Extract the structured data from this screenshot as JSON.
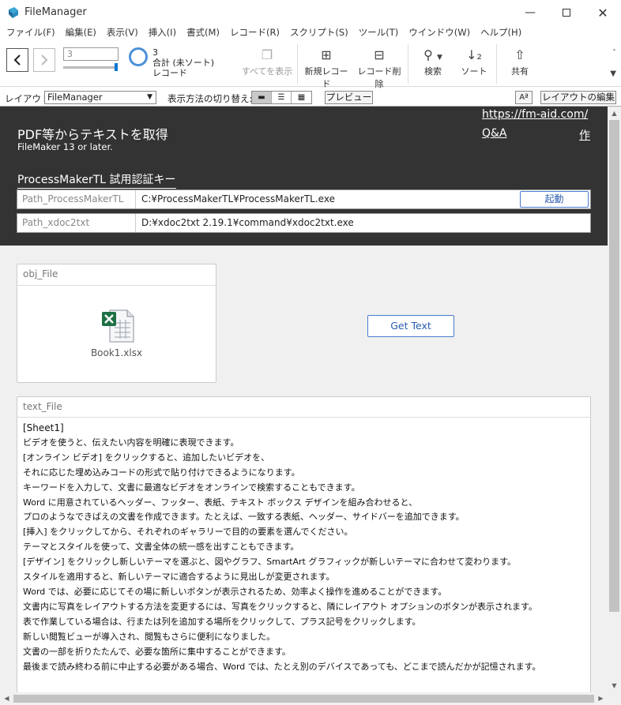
{
  "window": {
    "title": "FileManager"
  },
  "menu": [
    "ファイル(F)",
    "編集(E)",
    "表示(V)",
    "挿入(I)",
    "書式(M)",
    "レコード(R)",
    "スクリプト(S)",
    "ツール(T)",
    "ウインドウ(W)",
    "ヘルプ(H)"
  ],
  "toolbar": {
    "record_input": "3",
    "record_count": "3",
    "record_status": "合計 (未ソート)",
    "record_unit": "レコード",
    "show_all": "すべてを表示",
    "new_record": "新規レコード",
    "delete_record": "レコード削除",
    "search": "検索",
    "sort": "ソート",
    "share": "共有"
  },
  "layoutbar": {
    "layout_label": "レイアウト:",
    "layout_value": "FileManager",
    "view_label": "表示方法の切り替え:",
    "preview": "プレビュー",
    "font_btn": "Aª",
    "edit_layout": "レイアウトの編集"
  },
  "header": {
    "title": "PDF等からテキストを取得",
    "subtitle": "FileMaker 13 or later.",
    "site_link": "https://fm-aid.com/",
    "qa_link": "Q&A",
    "author_link": "作",
    "license_label": "ProcessMakerTL 試用認証キー",
    "fields": [
      {
        "name": "Path_ProcessMakerTL",
        "value": "C:¥ProcessMakerTL¥ProcessMakerTL.exe"
      },
      {
        "name": "Path_xdoc2txt",
        "value": "D:¥xdoc2txt 2.19.1¥command¥xdoc2txt.exe"
      }
    ],
    "launch_button": "起動"
  },
  "obj_file": {
    "label": "obj_File",
    "filename": "Book1.xlsx"
  },
  "get_text_button": "Get Text",
  "text_file": {
    "label": "text_File",
    "lines": [
      "[Sheet1]",
      "ビデオを使うと、伝えたい内容を明確に表現できます。",
      "[オンライン ビデオ] をクリックすると、追加したいビデオを、",
      "それに応じた埋め込みコードの形式で貼り付けできるようになります。",
      "キーワードを入力して、文書に最適なビデオをオンラインで検索することもできます。",
      "Word に用意されているヘッダー、フッター、表紙、テキスト ボックス デザインを組み合わせると、",
      "プロのようなできばえの文書を作成できます。たとえば、一致する表紙、ヘッダー、サイドバーを追加できます。",
      "[挿入] をクリックしてから、それぞれのギャラリーで目的の要素を選んでください。",
      "テーマとスタイルを使って、文書全体の統一感を出すこともできます。",
      "[デザイン] をクリックし新しいテーマを選ぶと、図やグラフ、SmartArt グラフィックが新しいテーマに合わせて変わります。",
      "スタイルを適用すると、新しいテーマに適合するように見出しが変更されます。",
      "Word では、必要に応じてその場に新しいボタンが表示されるため、効率よく操作を進めることができます。",
      "文書内に写真をレイアウトする方法を変更するには、写真をクリックすると、隣にレイアウト オプションのボタンが表示されます。",
      "表で作業している場合は、行または列を追加する場所をクリックして、プラス記号をクリックします。",
      "新しい閲覧ビューが導入され、閲覧もさらに便利になりました。",
      "文書の一部を折りたたんで、必要な箇所に集中することができます。",
      "最後まで読み終わる前に中止する必要がある場合、Word では、たとえ別のデバイスであっても、どこまで読んだかが記憶されます。"
    ]
  }
}
